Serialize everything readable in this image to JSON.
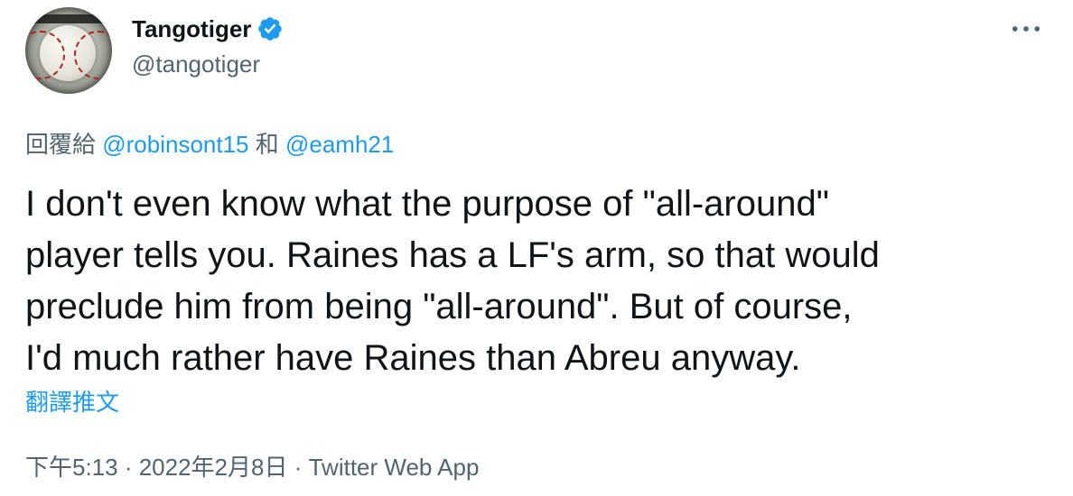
{
  "author": {
    "display_name": "Tangotiger",
    "handle": "@tangotiger",
    "verified": true,
    "verified_color": "#1d9bf0"
  },
  "reply": {
    "prefix": "回覆給 ",
    "mention_1": "@robinsont15",
    "conjunction": " 和 ",
    "mention_2": "@eamh21"
  },
  "tweet": {
    "text": "I don't even know what the purpose of \"all-around\"\nplayer tells you.  Raines has a LF's arm, so that would\npreclude him from being \"all-around\".  But of course,\nI'd much rather have Raines than Abreu anyway."
  },
  "translate_label": "翻譯推文",
  "meta": {
    "time": "下午5:13",
    "separator": " · ",
    "date": "2022年2月8日",
    "source": "Twitter Web App"
  },
  "colors": {
    "text": "#0f1419",
    "secondary": "#536471",
    "accent": "#1d9bf0"
  },
  "icons": {
    "more": "more-horizontal-icon",
    "verified": "verified-badge-icon"
  }
}
